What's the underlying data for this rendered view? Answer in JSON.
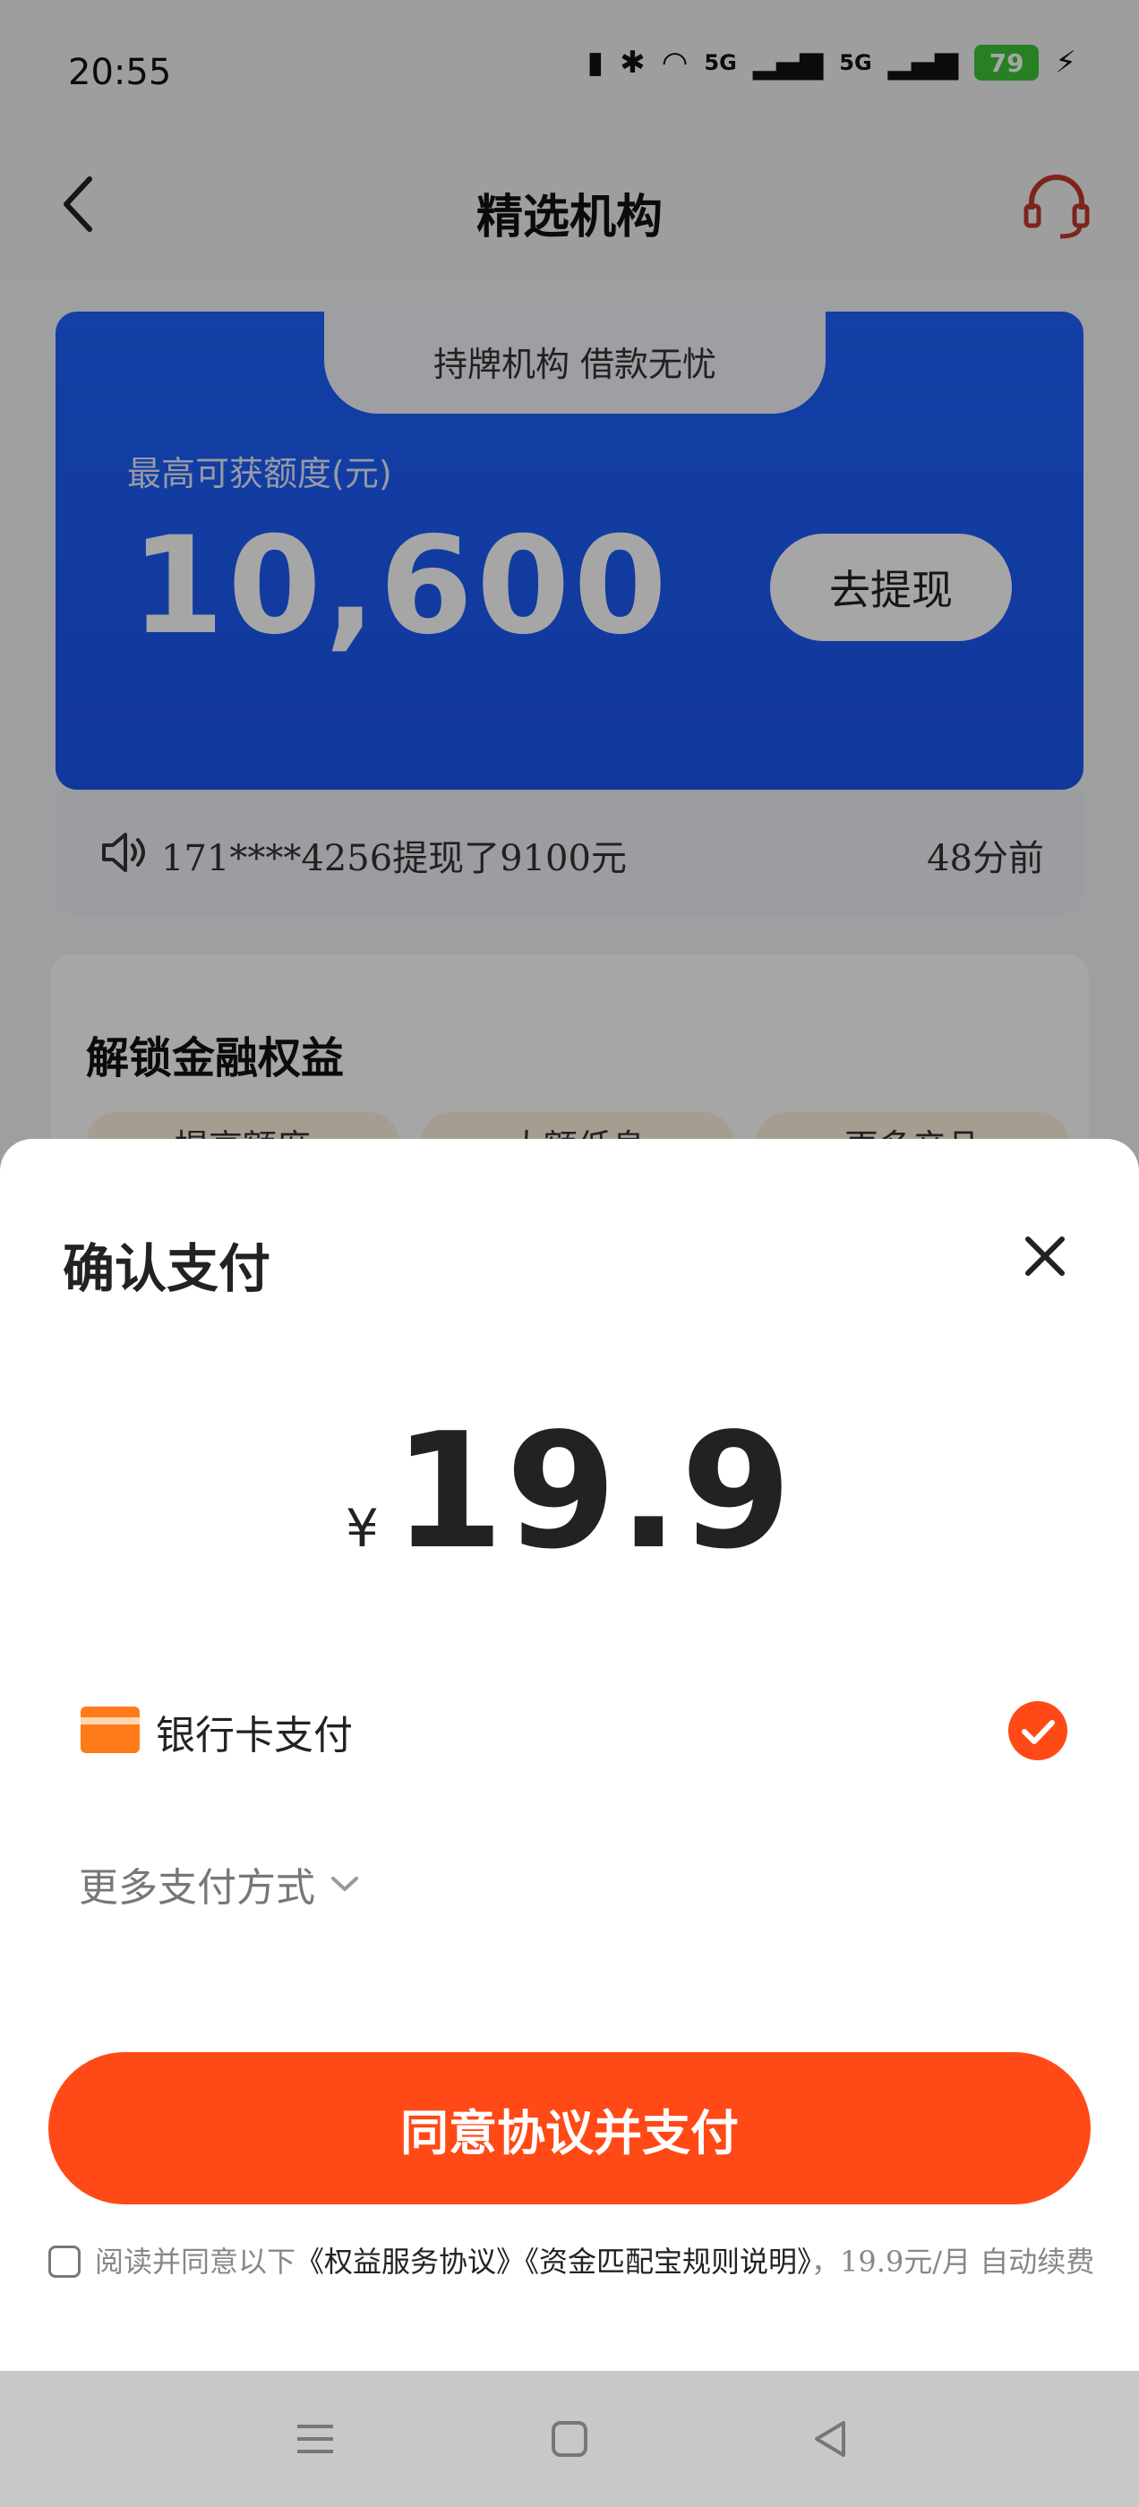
{
  "status_bar": {
    "time": "20:55",
    "battery": "79",
    "signal_1": "5G",
    "signal_2": "5G"
  },
  "nav": {
    "title": "精选机构"
  },
  "credit_card": {
    "tab_text": "持牌机构  借款无忧",
    "limit_label": "最高可获额度(元)",
    "limit_value": "10,600",
    "withdraw_label": "去提现"
  },
  "notice": {
    "text": "171****4256提现了9100元",
    "time": "48分前"
  },
  "rights": {
    "title": "解锁金融权益",
    "tabs": [
      "提高额度",
      "大额低息",
      "更多产品"
    ]
  },
  "payment_sheet": {
    "title": "确认支付",
    "currency": "¥",
    "amount": "19.9",
    "method_label": "银行卡支付",
    "more_methods": "更多支付方式",
    "pay_button": "同意协议并支付",
    "agreement_prefix": "阅读并同意以下",
    "agreement_link1": "《权益服务协议》",
    "agreement_link2": "《资金匹配宝规则说明》",
    "agreement_suffix": "，19.9元/月 自动续费"
  },
  "colors": {
    "primary_blue": "#1e62ff",
    "pay_orange": "#ff4917",
    "battery_green": "#3ec53a"
  }
}
